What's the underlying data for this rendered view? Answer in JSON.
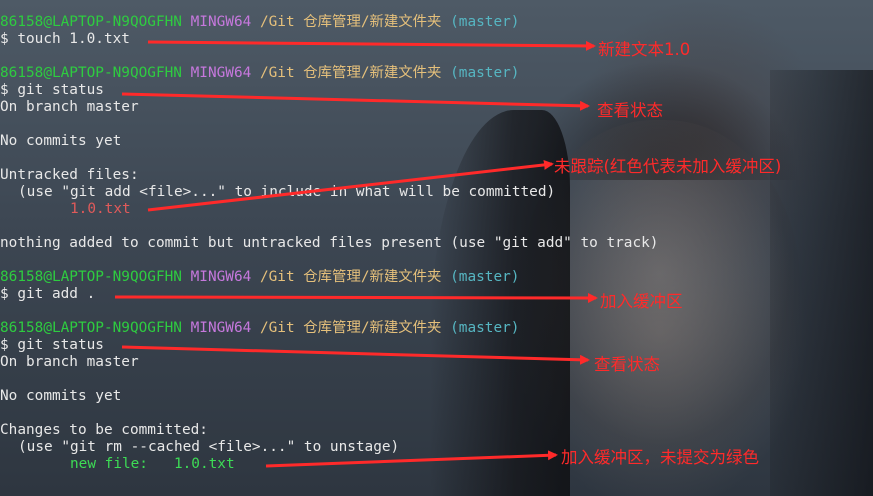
{
  "prompt": {
    "user_host": "86158@LAPTOP-N9QOGFHN",
    "shell": "MINGW64",
    "path": "/Git 仓库管理/新建文件夹",
    "branch": "(master)"
  },
  "lines": {
    "cmd1": "$ touch 1.0.txt",
    "cmd2": "$ git status",
    "out_on_branch": "On branch master",
    "out_no_commits": "No commits yet",
    "out_untracked": "Untracked files:",
    "out_use_add": "(use \"git add <file>...\" to include in what will be committed)",
    "out_untracked_file": "1.0.txt",
    "out_nothing_added": "nothing added to commit but untracked files present (use \"git add\" to track)",
    "cmd3": "$ git add .",
    "cmd4": "$ git status",
    "out_on_branch2": "On branch master",
    "out_no_commits2": "No commits yet",
    "out_changes": "Changes to be committed:",
    "out_use_rm": "(use \"git rm --cached <file>...\" to unstage)",
    "out_new_file": "new file:   1.0.txt"
  },
  "annotations": {
    "a1": "新建文本1.0",
    "a2": "查看状态",
    "a3": "未跟踪(红色代表未加入缓冲区)",
    "a4": "加入缓冲区",
    "a5": "查看状态",
    "a6": "加入缓冲区，未提交为绿色"
  },
  "colors": {
    "annotation": "#ff2a2a",
    "prompt_user": "#2ecc40",
    "prompt_shell": "#c678dd",
    "prompt_path": "#e5c07b",
    "prompt_branch": "#56b6c2",
    "untracked": "#e05a5a",
    "staged": "#3ddc55"
  }
}
